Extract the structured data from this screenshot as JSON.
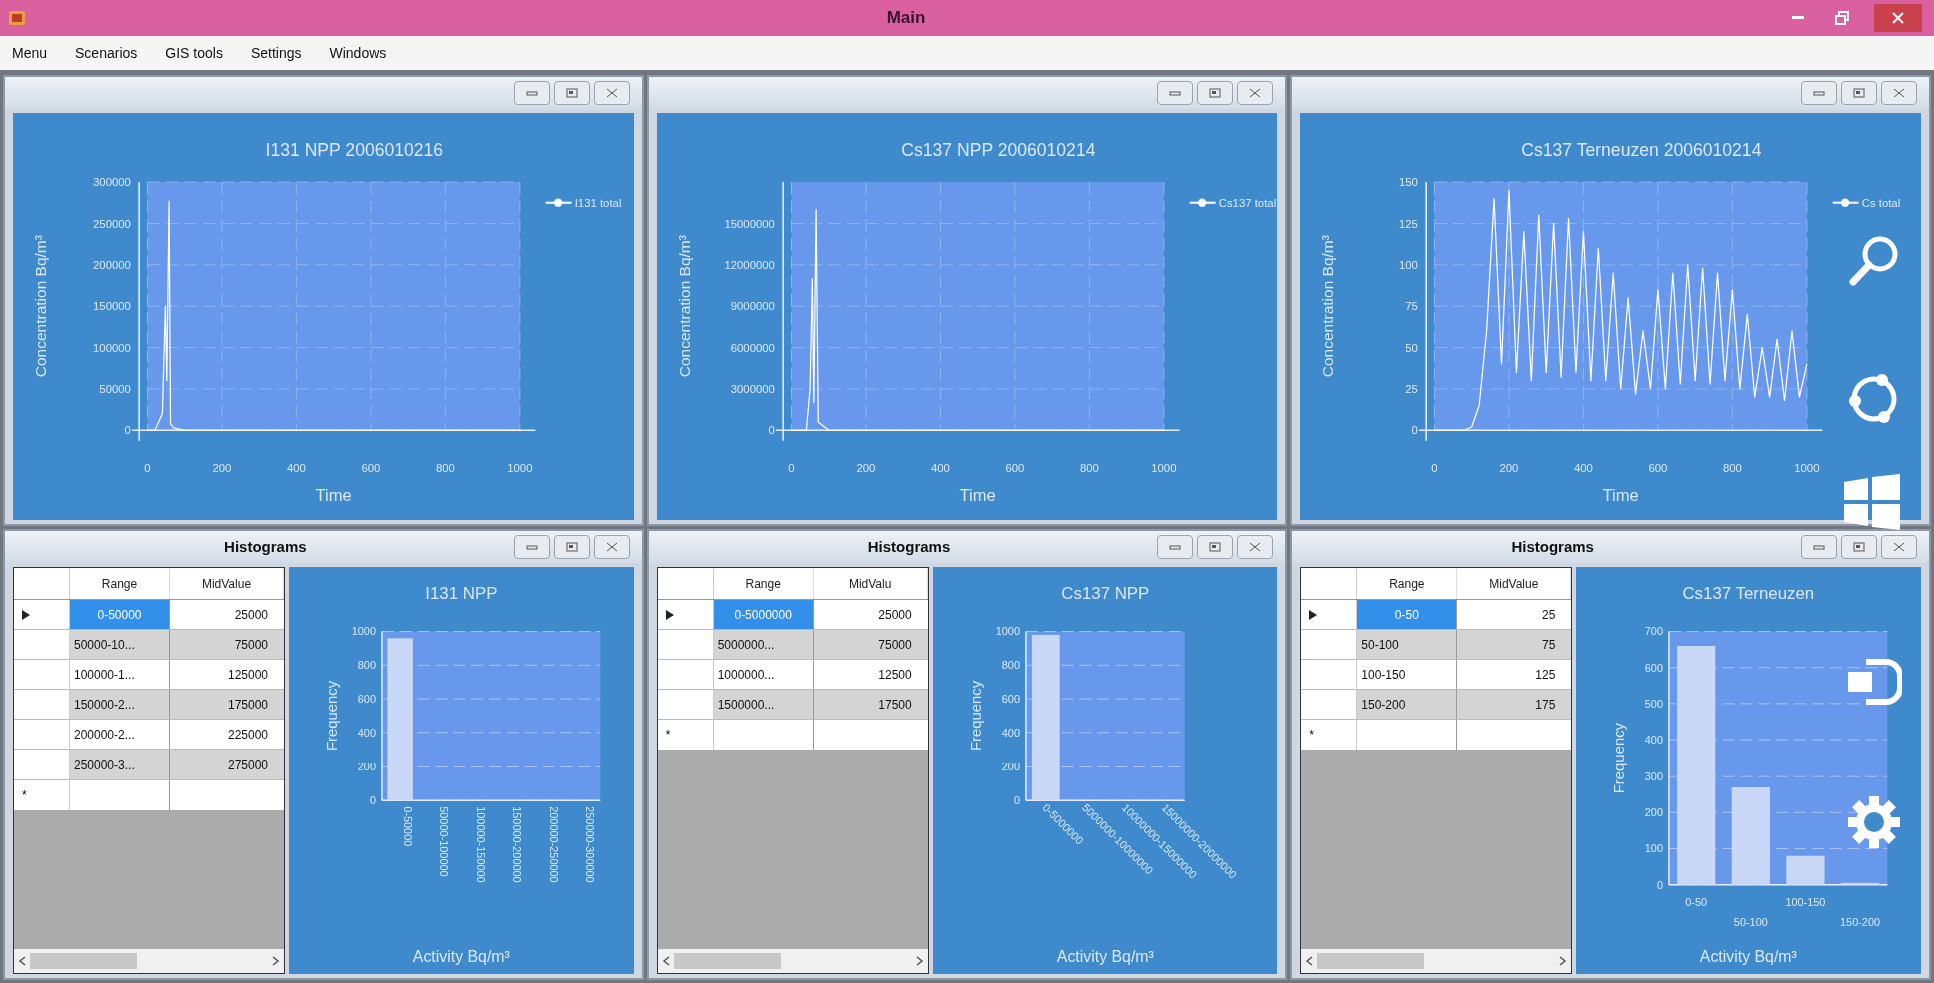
{
  "window": {
    "title": "Main"
  },
  "menu": [
    "Menu",
    "Scenarios",
    "GIS tools",
    "Settings",
    "Windows"
  ],
  "chart_windows": [
    {
      "chart_data": {
        "type": "line",
        "title": "I131 NPP 2006010216",
        "xlabel": "Time",
        "ylabel": "Concentration Bq/m³",
        "xlim": [
          0,
          1000
        ],
        "ylim": [
          0,
          300000
        ],
        "xticks": [
          0,
          200,
          400,
          600,
          800,
          1000
        ],
        "yticks": [
          0,
          50000,
          100000,
          150000,
          200000,
          250000,
          300000
        ],
        "series": [
          {
            "name": "I131 total",
            "color": "#ffffff",
            "x": [
              0,
              20,
              40,
              48,
              52,
              58,
              62,
              70,
              100,
              200,
              400,
              600,
              800,
              1000
            ],
            "values": [
              0,
              0,
              20000,
              150000,
              60000,
              277000,
              8000,
              3000,
              0,
              0,
              0,
              0,
              0,
              0
            ]
          }
        ],
        "grid": true
      }
    },
    {
      "chart_data": {
        "type": "line",
        "title": "Cs137 NPP 2006010214",
        "xlabel": "Time",
        "ylabel": "Concentration Bq/m³",
        "xlim": [
          0,
          1000
        ],
        "ylim": [
          0,
          18000000
        ],
        "xticks": [
          0,
          200,
          400,
          600,
          800,
          1000
        ],
        "yticks": [
          0,
          3000000,
          6000000,
          9000000,
          12000000,
          15000000
        ],
        "series": [
          {
            "name": "Cs137 total",
            "color": "#ffffff",
            "x": [
              0,
              20,
              40,
              50,
              56,
              60,
              66,
              72,
              100,
              200,
              400,
              600,
              800,
              1000
            ],
            "values": [
              0,
              0,
              0,
              3000000,
              11000000,
              2000000,
              16000000,
              600000,
              0,
              0,
              0,
              0,
              0,
              0
            ]
          }
        ],
        "grid": true
      }
    },
    {
      "chart_data": {
        "type": "line",
        "title": "Cs137 Terneuzen 2006010214",
        "xlabel": "Time",
        "ylabel": "Concentration Bq/m³",
        "xlim": [
          0,
          1000
        ],
        "ylim": [
          0,
          150
        ],
        "xticks": [
          0,
          200,
          400,
          600,
          800,
          1000
        ],
        "yticks": [
          0,
          25,
          50,
          75,
          100,
          125,
          150
        ],
        "series": [
          {
            "name": "Cs total",
            "color": "#ffffff",
            "x": [
              0,
              20,
              40,
              60,
              80,
              100,
              120,
              140,
              160,
              180,
              200,
              220,
              240,
              260,
              280,
              300,
              320,
              340,
              360,
              380,
              400,
              420,
              440,
              460,
              480,
              500,
              520,
              540,
              560,
              580,
              600,
              620,
              640,
              660,
              680,
              700,
              720,
              740,
              760,
              780,
              800,
              820,
              840,
              860,
              880,
              900,
              920,
              940,
              960,
              980,
              1000
            ],
            "values": [
              0,
              0,
              0,
              0,
              0,
              2,
              15,
              60,
              140,
              40,
              145,
              35,
              120,
              30,
              130,
              35,
              125,
              32,
              128,
              35,
              120,
              30,
              110,
              30,
              95,
              25,
              80,
              22,
              60,
              25,
              85,
              25,
              95,
              28,
              100,
              30,
              98,
              28,
              95,
              30,
              85,
              25,
              70,
              20,
              50,
              20,
              55,
              18,
              60,
              20,
              40
            ]
          }
        ],
        "grid": true
      }
    }
  ],
  "histogram_windows": [
    {
      "title": "Histograms",
      "table": {
        "columns": [
          "Range",
          "MidValue"
        ],
        "new_row_marker": "*",
        "rows": [
          {
            "range": "0-50000",
            "mid_value": "25000",
            "selected": true
          },
          {
            "range": "50000-10...",
            "mid_value": "75000",
            "selected": false
          },
          {
            "range": "100000-1...",
            "mid_value": "125000",
            "selected": false
          },
          {
            "range": "150000-2...",
            "mid_value": "175000",
            "selected": false
          },
          {
            "range": "200000-2...",
            "mid_value": "225000",
            "selected": false
          },
          {
            "range": "250000-3...",
            "mid_value": "275000",
            "selected": false
          }
        ]
      },
      "chart_data": {
        "type": "bar",
        "title": "I131 NPP",
        "xlabel": "Activity Bq/m³",
        "ylabel": "Frequency",
        "ylim": [
          0,
          1000
        ],
        "yticks": [
          0,
          200,
          400,
          600,
          800,
          1000
        ],
        "categories": [
          "0-50000",
          "50000-100000",
          "100000-150000",
          "150000-200000",
          "200000-250000",
          "250000-300000"
        ],
        "values": [
          960,
          null,
          null,
          null,
          null,
          null
        ],
        "grid": true
      }
    },
    {
      "title": "Histograms",
      "table": {
        "columns": [
          "Range",
          "MidValu"
        ],
        "new_row_marker": "*",
        "rows": [
          {
            "range": "0-5000000",
            "mid_value": "25000",
            "selected": true
          },
          {
            "range": "5000000...",
            "mid_value": "75000",
            "selected": false
          },
          {
            "range": "1000000...",
            "mid_value": "12500",
            "selected": false
          },
          {
            "range": "1500000...",
            "mid_value": "17500",
            "selected": false
          }
        ]
      },
      "chart_data": {
        "type": "bar",
        "title": "Cs137 NPP",
        "xlabel": "Activity Bq/m³",
        "ylabel": "Frequency",
        "ylim": [
          0,
          1000
        ],
        "yticks": [
          0,
          200,
          400,
          600,
          800,
          1000
        ],
        "categories": [
          "0-5000000",
          "5000000-10000000",
          "10000000-15000000",
          "15000000-20000000"
        ],
        "values": [
          980,
          null,
          null,
          null
        ],
        "grid": true
      }
    },
    {
      "title": "Histograms",
      "table": {
        "columns": [
          "Range",
          "MidValue"
        ],
        "new_row_marker": "*",
        "rows": [
          {
            "range": "0-50",
            "mid_value": "25",
            "selected": true
          },
          {
            "range": "50-100",
            "mid_value": "75",
            "selected": false
          },
          {
            "range": "100-150",
            "mid_value": "125",
            "selected": false
          },
          {
            "range": "150-200",
            "mid_value": "175",
            "selected": false
          }
        ]
      },
      "chart_data": {
        "type": "bar",
        "title": "Cs137 Terneuzen",
        "xlabel": "Activity Bq/m³",
        "ylabel": "Frequency",
        "ylim": [
          0,
          700
        ],
        "yticks": [
          0,
          100,
          200,
          300,
          400,
          500,
          600,
          700
        ],
        "categories": [
          "0-50",
          "50-100",
          "100-150",
          "150-200"
        ],
        "values": [
          660,
          270,
          80,
          5
        ],
        "grid": true
      }
    }
  ]
}
